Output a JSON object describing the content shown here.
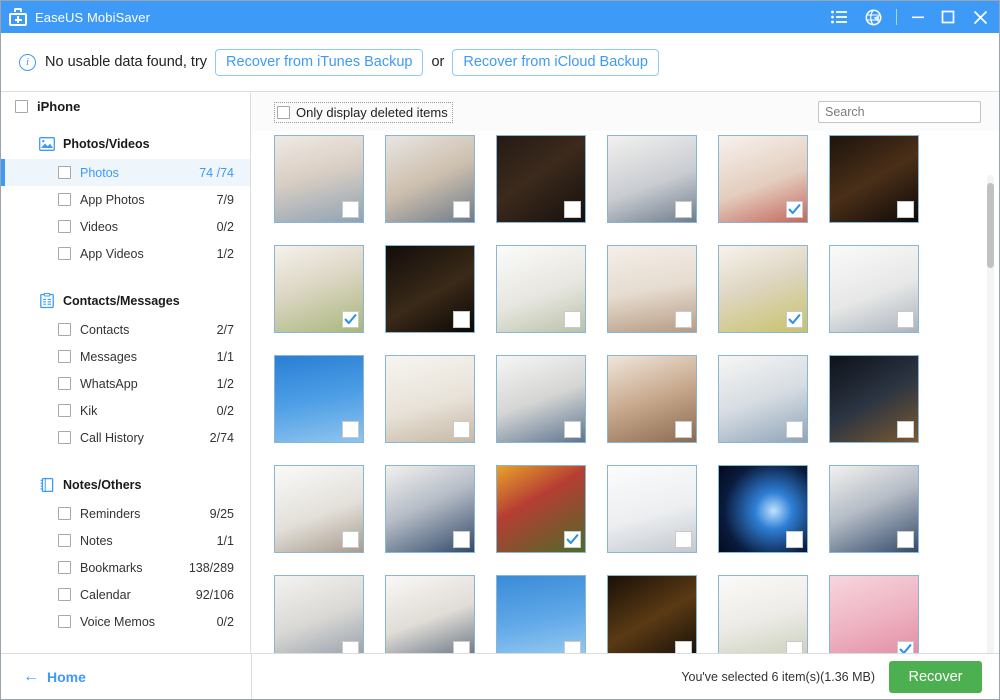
{
  "titlebar": {
    "app_name": "EaseUS MobiSaver",
    "app_icon": "first-aid-kit-icon",
    "menu_icon": "list-menu-icon",
    "globe_icon": "globe-icon",
    "minimize_label": "—",
    "maximize_label": "☐",
    "close_label": "✕",
    "accent": "#3d9bf7"
  },
  "notice": {
    "info_icon": "info-circle-icon",
    "message": "No usable data found, try",
    "itunes_button": "Recover from iTunes Backup",
    "or_text": "or",
    "icloud_button": "Recover from iCloud Backup"
  },
  "sidebar": {
    "root_label": "iPhone",
    "sections": [
      {
        "label": "Photos/Videos",
        "icon": "photo-icon",
        "items": [
          {
            "label": "Photos",
            "count": "74 /74",
            "active": true
          },
          {
            "label": "App Photos",
            "count": "7/9",
            "active": false
          },
          {
            "label": "Videos",
            "count": "0/2",
            "active": false
          },
          {
            "label": "App Videos",
            "count": "1/2",
            "active": false
          }
        ]
      },
      {
        "label": "Contacts/Messages",
        "icon": "clipboard-icon",
        "items": [
          {
            "label": "Contacts",
            "count": "2/7",
            "active": false
          },
          {
            "label": "Messages",
            "count": "1/1",
            "active": false
          },
          {
            "label": "WhatsApp",
            "count": "1/2",
            "active": false
          },
          {
            "label": "Kik",
            "count": "0/2",
            "active": false
          },
          {
            "label": "Call History",
            "count": "2/74",
            "active": false
          }
        ]
      },
      {
        "label": "Notes/Others",
        "icon": "notebook-icon",
        "items": [
          {
            "label": "Reminders",
            "count": "9/25",
            "active": false
          },
          {
            "label": "Notes",
            "count": "1/1",
            "active": false
          },
          {
            "label": "Bookmarks",
            "count": "138/289",
            "active": false
          },
          {
            "label": "Calendar",
            "count": "92/106",
            "active": false
          },
          {
            "label": "Voice Memos",
            "count": "0/2",
            "active": false
          }
        ]
      }
    ]
  },
  "content": {
    "only_deleted_label": "Only display deleted items",
    "only_deleted_checked": false,
    "search_placeholder": "Search",
    "search_value": "",
    "thumbnails": [
      {
        "id": 1,
        "checked": false,
        "art": "family-kitchen-laptop"
      },
      {
        "id": 2,
        "checked": false,
        "art": "office-couple-desk"
      },
      {
        "id": 3,
        "checked": false,
        "art": "dark-woman-laptop"
      },
      {
        "id": 4,
        "checked": false,
        "art": "woman-window-laptop"
      },
      {
        "id": 5,
        "checked": true,
        "art": "mother-child-gift"
      },
      {
        "id": 6,
        "checked": false,
        "art": "night-woman-desk"
      },
      {
        "id": 7,
        "checked": true,
        "art": "girl-hugging-mother-tulips"
      },
      {
        "id": 8,
        "checked": false,
        "art": "night-city-man-laptop"
      },
      {
        "id": 9,
        "checked": false,
        "art": "bright-living-room"
      },
      {
        "id": 10,
        "checked": false,
        "art": "wood-table-balloons"
      },
      {
        "id": 11,
        "checked": true,
        "art": "woman-yellow-tulips"
      },
      {
        "id": 12,
        "checked": false,
        "art": "man-white-desk-shelf"
      },
      {
        "id": 13,
        "checked": false,
        "art": "blue-sky-clouds"
      },
      {
        "id": 14,
        "checked": false,
        "art": "empty-dining-room"
      },
      {
        "id": 15,
        "checked": false,
        "art": "man-beard-laptop"
      },
      {
        "id": 16,
        "checked": false,
        "art": "meeting-table-group"
      },
      {
        "id": 17,
        "checked": false,
        "art": "two-businessmen-tablet"
      },
      {
        "id": 18,
        "checked": false,
        "art": "night-window-couple"
      },
      {
        "id": 19,
        "checked": false,
        "art": "woman-desk-glasses"
      },
      {
        "id": 20,
        "checked": false,
        "art": "team-around-monitor"
      },
      {
        "id": 21,
        "checked": true,
        "art": "woman-colorful-umbrella"
      },
      {
        "id": 22,
        "checked": false,
        "art": "two-men-handshake-bright"
      },
      {
        "id": 23,
        "checked": false,
        "art": "earth-space-blue"
      },
      {
        "id": 24,
        "checked": false,
        "art": "team-around-monitor-2"
      },
      {
        "id": 25,
        "checked": false,
        "art": "conference-room-people"
      },
      {
        "id": 26,
        "checked": false,
        "art": "man-bookshelf-thinking"
      },
      {
        "id": 27,
        "checked": false,
        "art": "blue-sky-clouds-2"
      },
      {
        "id": 28,
        "checked": false,
        "art": "woman-bar-lights"
      },
      {
        "id": 29,
        "checked": false,
        "art": "child-mother-balloons"
      },
      {
        "id": 30,
        "checked": true,
        "art": "pink-roses-card"
      }
    ]
  },
  "bottom": {
    "home_arrow": "←",
    "home_label": "Home",
    "selection_text": "You've selected 6 item(s)(1.36 MB)",
    "recover_label": "Recover",
    "recover_color": "#4caf50"
  }
}
